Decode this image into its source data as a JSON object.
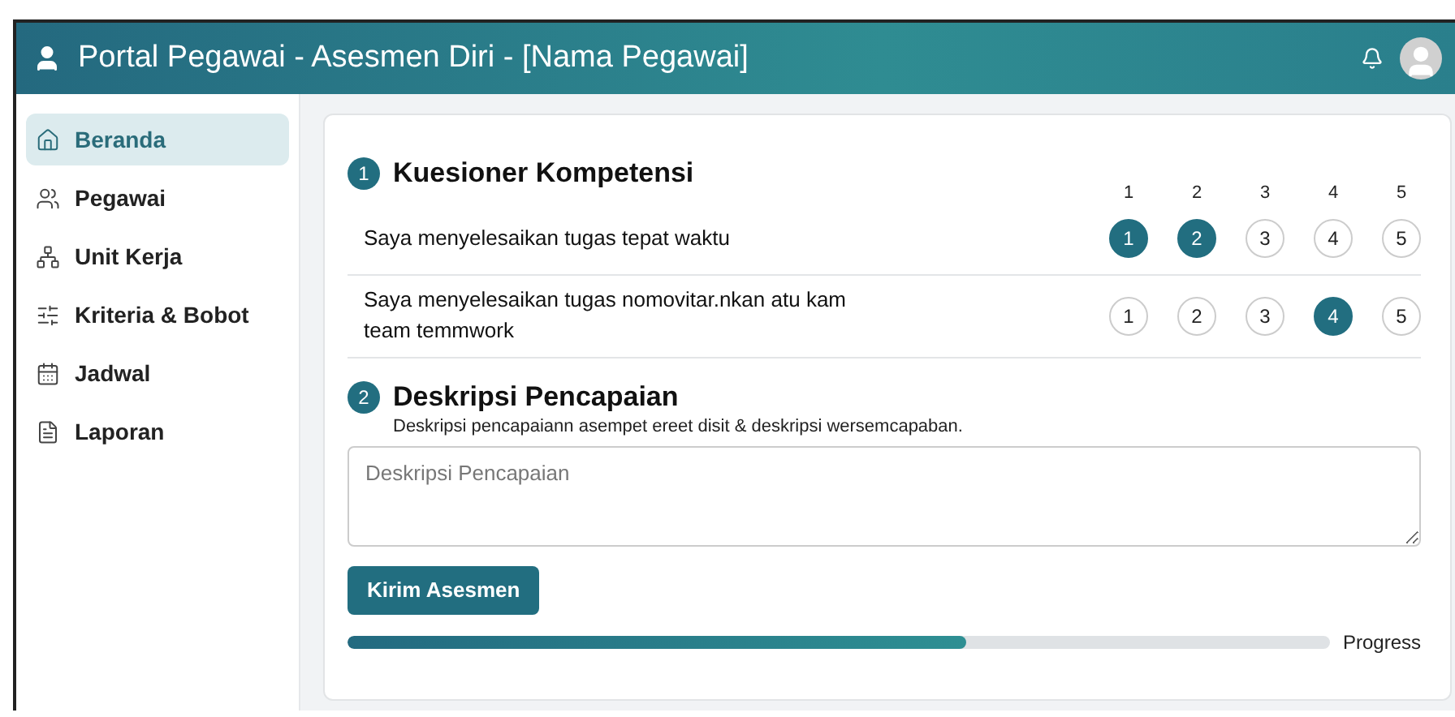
{
  "header": {
    "title": "Portal Pegawai - Asesmen Diri - [Nama Pegawai]"
  },
  "sidebar": {
    "items": [
      {
        "label": "Beranda",
        "selected": true
      },
      {
        "label": "Pegawai",
        "selected": false
      },
      {
        "label": "Unit Kerja",
        "selected": false
      },
      {
        "label": "Kriteria & Bobot",
        "selected": false
      },
      {
        "label": "Jadwal",
        "selected": false
      },
      {
        "label": "Laporan",
        "selected": false
      }
    ]
  },
  "questionnaire": {
    "number": "1",
    "title": "Kuesioner Kompetensi",
    "scale": [
      "1",
      "2",
      "3",
      "4",
      "5"
    ],
    "rows": [
      {
        "text": "Saya menyelesaikan tugas tepat waktu",
        "options": [
          {
            "label": "1",
            "selected": true
          },
          {
            "label": "2",
            "selected": true
          },
          {
            "label": "3",
            "selected": false
          },
          {
            "label": "4",
            "selected": false
          },
          {
            "label": "5",
            "selected": false
          }
        ]
      },
      {
        "text": "Saya menyelesaikan tugas nomovitar.nkan atu kam team temmwork",
        "options": [
          {
            "label": "1",
            "selected": false
          },
          {
            "label": "2",
            "selected": false
          },
          {
            "label": "3",
            "selected": false
          },
          {
            "label": "4",
            "selected": true
          },
          {
            "label": "5",
            "selected": false
          }
        ]
      }
    ]
  },
  "description": {
    "number": "2",
    "title": "Deskripsi Pencapaian",
    "hint": "Deskripsi pencapaiann asempet ereet disit & deskripsi wersemcapaban.",
    "placeholder": "Deskripsi Pencapaian"
  },
  "submit": {
    "label": "Kirim Asesmen"
  },
  "progress": {
    "level": 0.63,
    "label": "Progress"
  }
}
